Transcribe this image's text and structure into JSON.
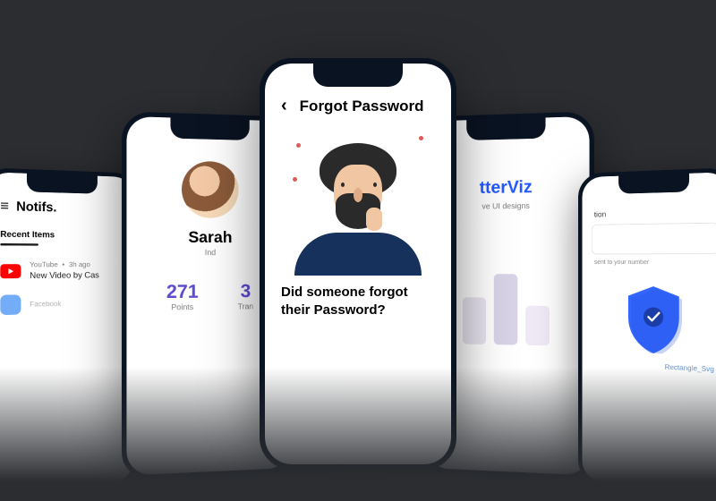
{
  "phone1": {
    "title": "Notifs.",
    "tab": "Recent Items",
    "item1_source": "YouTube",
    "item1_time": "3h ago",
    "item1_title": "New Video by Cas",
    "item2_source": "Facebook"
  },
  "phone2": {
    "name_partial": "Sarah",
    "location": "Ind",
    "stat1_value": "271",
    "stat1_label": "Points",
    "stat2_value": "3",
    "stat2_label": "Tran"
  },
  "phone3": {
    "title": "Forgot Password",
    "question": "Did someone forgot their Password?"
  },
  "phone4": {
    "brand_partial": "tterViz",
    "tagline_partial": "ve UI designs"
  },
  "phone5": {
    "field_label": "tion",
    "hint": "sent to your number",
    "annotation": "Rectangle_Svg"
  },
  "colors": {
    "accent_blue": "#3366ff",
    "youtube_red": "#ff0000",
    "stat_purple": "#5b4bcf"
  }
}
